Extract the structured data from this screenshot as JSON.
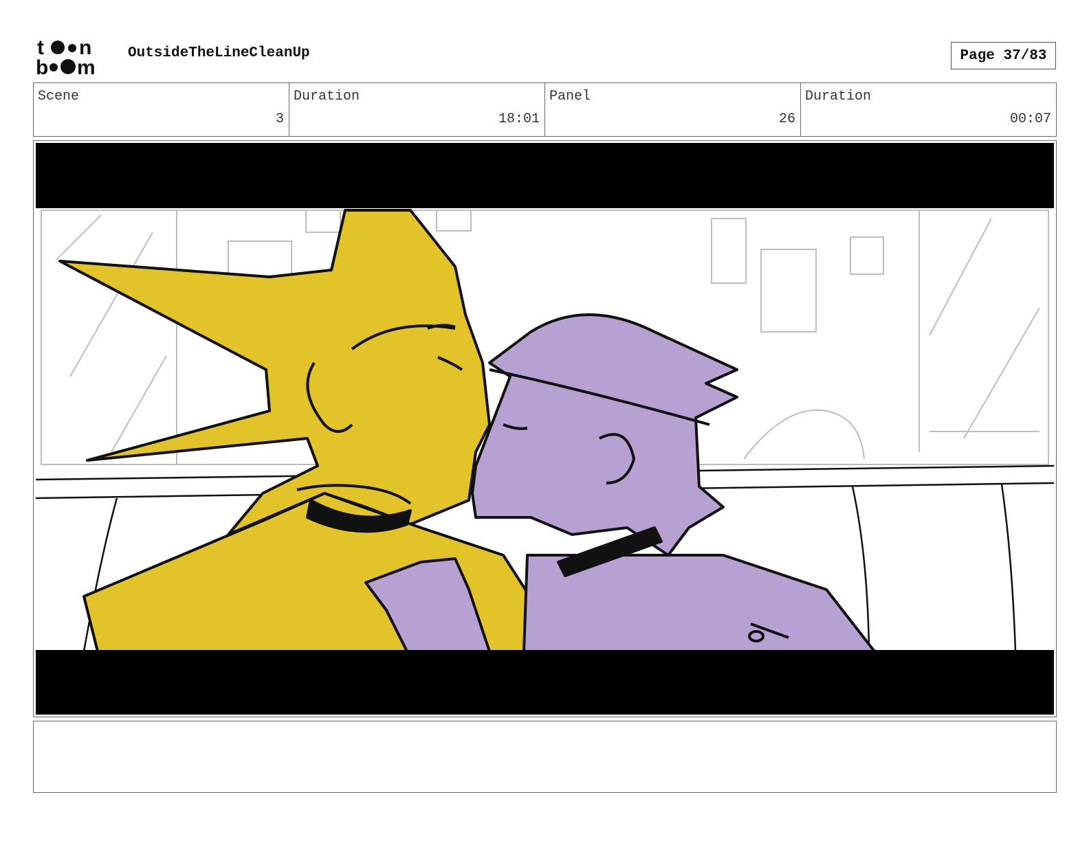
{
  "header": {
    "logo_name": "toonboom-logo",
    "project_title": "OutsideTheLineCleanUp",
    "page_label": "Page 37/83"
  },
  "info": {
    "scene_label": "Scene",
    "scene_value": "3",
    "scene_duration_label": "Duration",
    "scene_duration_value": "18:01",
    "panel_label": "Panel",
    "panel_value": "26",
    "panel_duration_label": "Duration",
    "panel_duration_value": "00:07"
  },
  "panel": {
    "colors": {
      "yellow_character": "#e2c42a",
      "purple_character": "#b7a0d2",
      "letterbox": "#000000",
      "sketch_lines": "#bbbbbb"
    }
  },
  "notes": {
    "text": ""
  }
}
